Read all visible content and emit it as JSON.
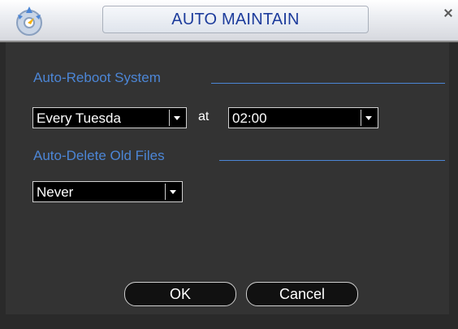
{
  "window": {
    "title": "AUTO MAINTAIN",
    "icon": "auto-maintain-logo-icon"
  },
  "reboot": {
    "section_title": "Auto-Reboot System",
    "day_select_value": "Every Tuesda",
    "at_label": "at",
    "time_select_value": "02:00"
  },
  "delete_files": {
    "section_title": "Auto-Delete Old Files",
    "select_value": "Never"
  },
  "buttons": {
    "ok_label": "OK",
    "cancel_label": "Cancel"
  },
  "colors": {
    "accent_blue": "#4c86d6",
    "title_blue": "#1d3c9c",
    "panel": "#333333"
  }
}
